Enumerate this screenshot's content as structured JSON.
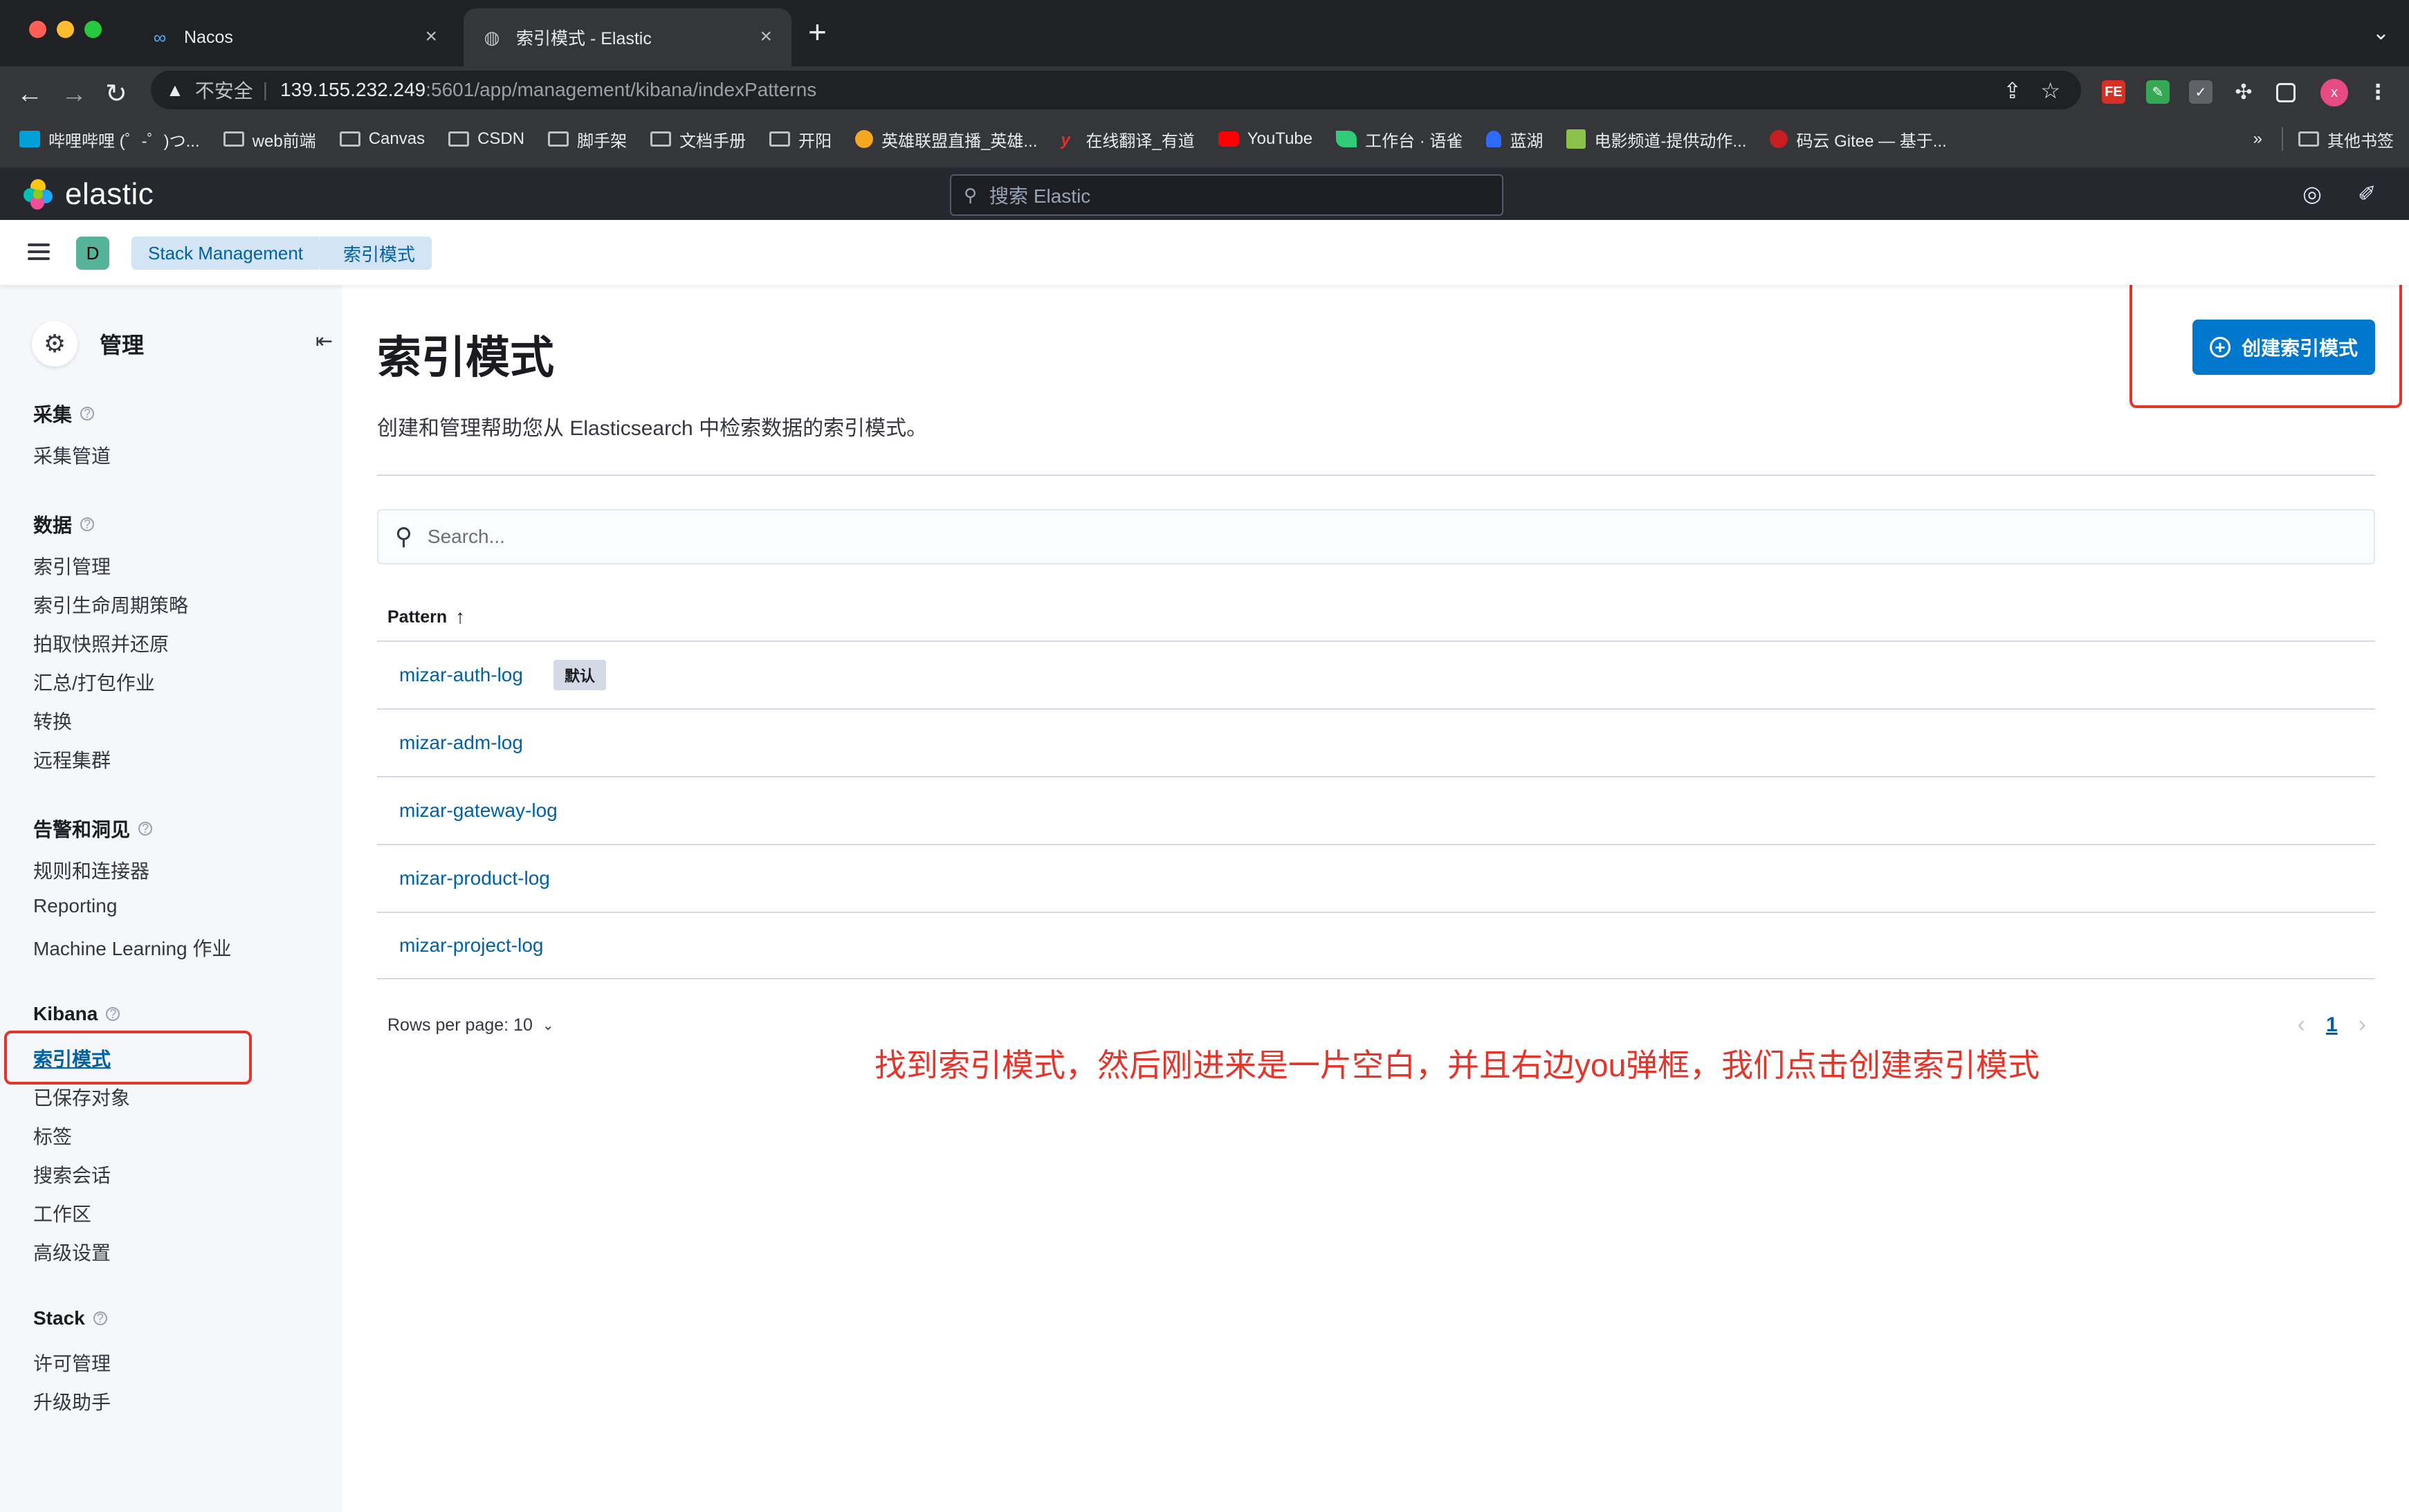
{
  "browser": {
    "tabs": [
      {
        "title": "Nacos",
        "icon": "infinity-icon",
        "active": false
      },
      {
        "title": "索引模式 - Elastic",
        "icon": "elastic-globe-icon",
        "active": true
      }
    ],
    "url": {
      "security_label": "不安全",
      "host": "139.155.232.249",
      "path": ":5601/app/management/kibana/indexPatterns"
    },
    "bookmarks": [
      "哔哩哔哩 (゜-゜)つ...",
      "web前端",
      "Canvas",
      "CSDN",
      "脚手架",
      "文档手册",
      "开阳",
      "英雄联盟直播_英雄...",
      "在线翻译_有道",
      "YouTube",
      "工作台 · 语雀",
      "蓝湖",
      "电影频道-提供动作...",
      "码云 Gitee — 基于..."
    ],
    "bookmarks_overflow": "»",
    "other_bookmarks": "其他书签",
    "profile_initial": "x"
  },
  "kibana": {
    "logo_text": "elastic",
    "search_placeholder": "搜索 Elastic",
    "space_initial": "D",
    "breadcrumbs": [
      "Stack Management",
      "索引模式"
    ]
  },
  "sidebar": {
    "title": "管理",
    "groups": [
      {
        "label": "采集",
        "items": [
          "采集管道"
        ]
      },
      {
        "label": "数据",
        "items": [
          "索引管理",
          "索引生命周期策略",
          "拍取快照并还原",
          "汇总/打包作业",
          "转换",
          "远程集群"
        ]
      },
      {
        "label": "告警和洞见",
        "items": [
          "规则和连接器",
          "Reporting",
          "Machine Learning 作业"
        ]
      },
      {
        "label": "Kibana",
        "items": [
          "索引模式",
          "已保存对象",
          "标签",
          "搜索会话",
          "工作区",
          "高级设置"
        ]
      },
      {
        "label": "Stack",
        "items": [
          "许可管理",
          "升级助手"
        ]
      }
    ],
    "active_item": "索引模式"
  },
  "main": {
    "title": "索引模式",
    "description": "创建和管理帮助您从 Elasticsearch 中检索数据的索引模式。",
    "create_button": "创建索引模式",
    "search_placeholder": "Search...",
    "column_header": "Pattern",
    "rows": [
      {
        "name": "mizar-auth-log",
        "badge": "默认"
      },
      {
        "name": "mizar-adm-log",
        "badge": ""
      },
      {
        "name": "mizar-gateway-log",
        "badge": ""
      },
      {
        "name": "mizar-product-log",
        "badge": ""
      },
      {
        "name": "mizar-project-log",
        "badge": ""
      }
    ],
    "rows_per_page": "Rows per page: 10",
    "current_page": "1"
  },
  "annotation": {
    "text": "找到索引模式，然后刚进来是一片空白，并且右边you弹框，我们点击创建索引模式",
    "color": "#e5352b"
  }
}
